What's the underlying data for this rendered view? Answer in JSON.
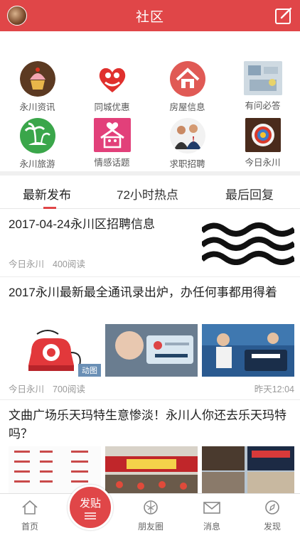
{
  "header": {
    "title": "社区",
    "avatar_icon": "user-avatar",
    "compose_icon": "compose-icon"
  },
  "grid": [
    {
      "label": "永川资讯",
      "icon": "cupcake-icon"
    },
    {
      "label": "同城优惠",
      "icon": "hearts-icon"
    },
    {
      "label": "房屋信息",
      "icon": "house-icon"
    },
    {
      "label": "有问必答",
      "icon": "qa-icon"
    },
    {
      "label": "永川旅游",
      "icon": "palm-island-icon"
    },
    {
      "label": "情感话题",
      "icon": "heart-house-icon"
    },
    {
      "label": "求职招聘",
      "icon": "job-people-icon"
    },
    {
      "label": "今日永川",
      "icon": "target-icon"
    }
  ],
  "tabs": [
    "最新发布",
    "72小时热点",
    "最后回复"
  ],
  "articles": [
    {
      "title": "2017-04-24永川区招聘信息",
      "source": "今日永川",
      "reads": "400阅读"
    },
    {
      "title": "2017永川最新最全通讯录出炉，办任何事都用得着",
      "source": "今日永川",
      "reads": "700阅读",
      "time": "昨天12:04",
      "badge": "动图"
    },
    {
      "title": "文曲广场乐天玛特生意惨淡！永川人你还去乐天玛特吗？"
    }
  ],
  "bottom_nav": [
    {
      "label": "首页",
      "icon": "home-icon"
    },
    {
      "label": "朋友圈",
      "icon": "moments-icon"
    },
    {
      "label": "消息",
      "icon": "mail-icon"
    },
    {
      "label": "发现",
      "icon": "compass-icon"
    }
  ],
  "post_button": "发贴",
  "colors": {
    "accent": "#e04648"
  }
}
